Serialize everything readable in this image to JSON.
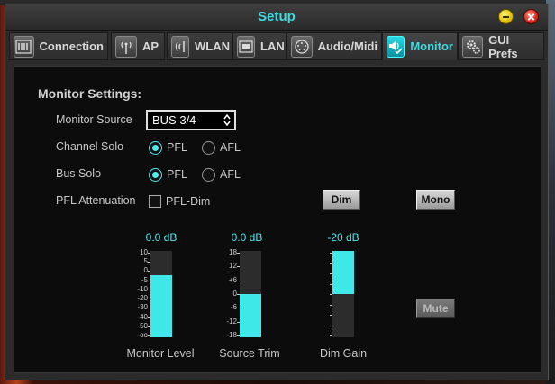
{
  "window": {
    "title": "Setup"
  },
  "tabs": [
    {
      "label": "Connection",
      "icon": "connection-icon",
      "active": false
    },
    {
      "label": "AP",
      "icon": "antenna-icon",
      "active": false
    },
    {
      "label": "WLAN",
      "icon": "wifi-icon",
      "active": false
    },
    {
      "label": "LAN",
      "icon": "ethernet-icon",
      "active": false
    },
    {
      "label": "Audio/Midi",
      "icon": "midi-icon",
      "active": false
    },
    {
      "label": "Monitor",
      "icon": "speaker-check-icon",
      "active": true
    },
    {
      "label": "GUI Prefs",
      "icon": "gears-icon",
      "active": false
    }
  ],
  "monitor": {
    "section_title": "Monitor Settings:",
    "source": {
      "label": "Monitor Source",
      "value": "BUS 3/4"
    },
    "channel_solo": {
      "label": "Channel Solo",
      "options": [
        "PFL",
        "AFL"
      ],
      "selected": "PFL"
    },
    "bus_solo": {
      "label": "Bus Solo",
      "options": [
        "PFL",
        "AFL"
      ],
      "selected": "PFL"
    },
    "pfl_attenuation": {
      "label": "PFL Attenuation",
      "checkbox_label": "PFL-Dim",
      "checked": false
    },
    "buttons": {
      "dim": "Dim",
      "mono": "Mono",
      "mute": "Mute"
    },
    "meters": [
      {
        "name": "Monitor Level",
        "value": "0.0 dB",
        "level": 0.72,
        "scale": [
          "10",
          "5",
          "0",
          "-5",
          "-10",
          "-20",
          "-30",
          "-40",
          "-50",
          "-oo"
        ]
      },
      {
        "name": "Source Trim",
        "value": "0.0 dB",
        "level": 0.5,
        "scale": [
          "18",
          "12",
          "+6",
          "0",
          "-6",
          "-12",
          "-18"
        ]
      },
      {
        "name": "Dim Gain",
        "value": "-20 dB",
        "level_top": 1.0,
        "level_bottom": 0.5
      }
    ]
  },
  "colors": {
    "accent": "#3fd9e0",
    "meter_fill": "#3ee8e8"
  }
}
